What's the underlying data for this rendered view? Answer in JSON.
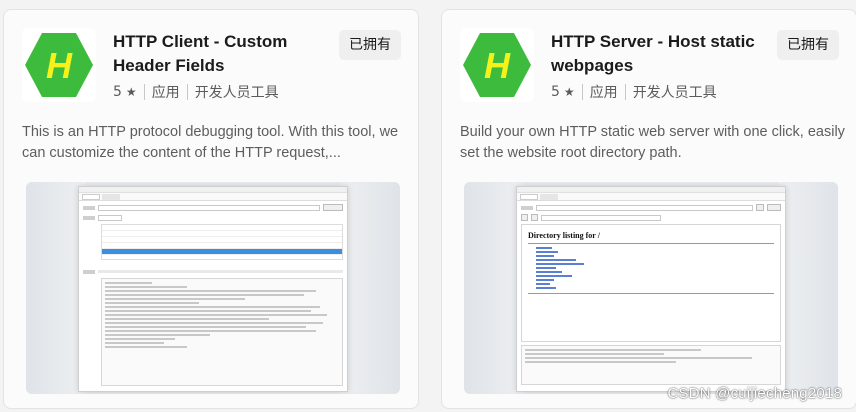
{
  "cards": [
    {
      "title": "HTTP Client - Custom Header Fields",
      "rating": "5",
      "star": "★",
      "category": "应用",
      "subcategory": "开发人员工具",
      "owned_label": "已拥有",
      "description": "This is an HTTP protocol debugging tool. With this tool, we can customize the content of the HTTP request,...",
      "logo_letter": "H",
      "logo_color": "#3dbb3d",
      "logo_letter_color": "#f4f21a"
    },
    {
      "title": "HTTP Server - Host static webpages",
      "rating": "5",
      "star": "★",
      "category": "应用",
      "subcategory": "开发人员工具",
      "owned_label": "已拥有",
      "description": "Build your own HTTP static web server with one click, easily set the website root directory path.",
      "logo_letter": "H",
      "logo_color": "#3dbb3d",
      "logo_letter_color": "#f4f21a",
      "preview_heading": "Directory listing for /"
    }
  ],
  "watermark": "CSDN @cuijiecheng2018"
}
